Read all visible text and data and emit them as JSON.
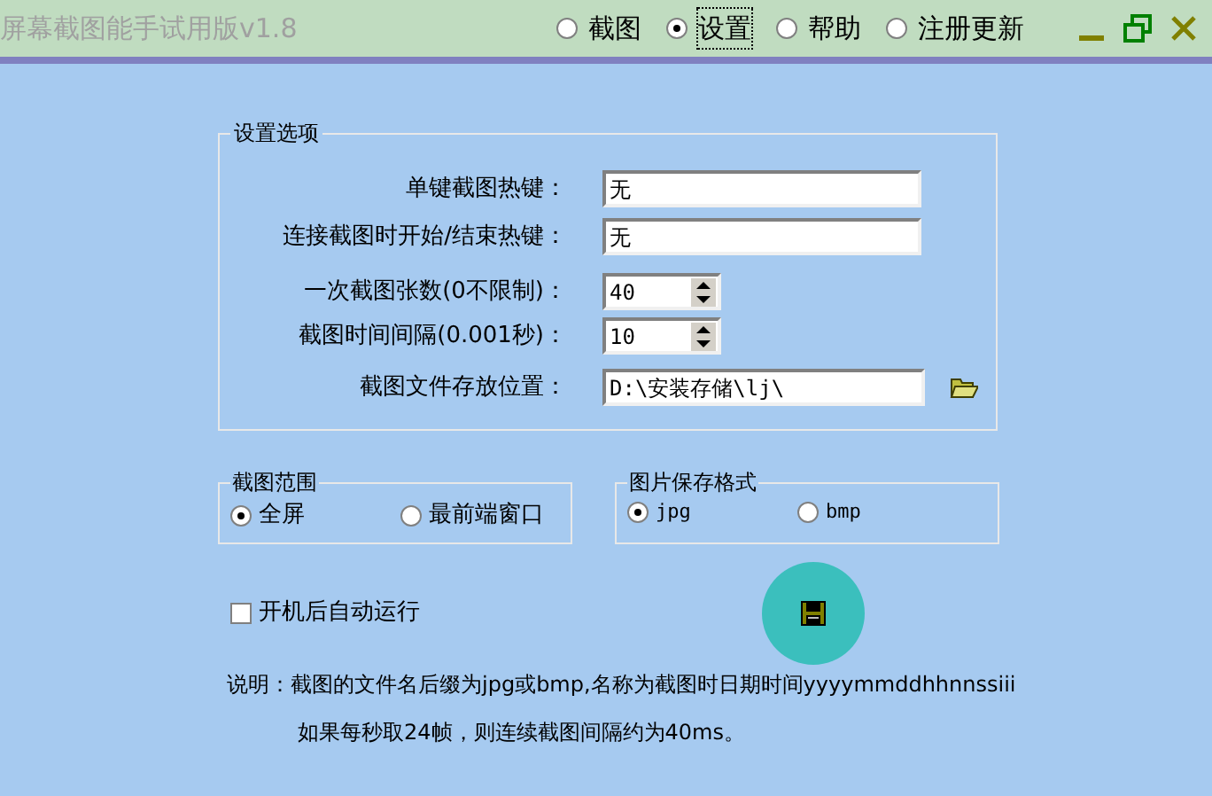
{
  "window": {
    "title": "屏幕截图能手试用版v1.8"
  },
  "nav_tabs": [
    {
      "label": "截图",
      "selected": false
    },
    {
      "label": "设置",
      "selected": true
    },
    {
      "label": "帮助",
      "selected": false
    },
    {
      "label": "注册更新",
      "selected": false
    }
  ],
  "settings_group": {
    "title": "设置选项",
    "fields": [
      {
        "kind": "text",
        "label": "单键截图热键：",
        "value": "无"
      },
      {
        "kind": "text",
        "label": "连接截图时开始/结束热键：",
        "value": "无"
      },
      {
        "kind": "spin",
        "label": "一次截图张数(0不限制)：",
        "value": "40"
      },
      {
        "kind": "spin",
        "label": "截图时间间隔(0.001秒)：",
        "value": "10"
      },
      {
        "kind": "path",
        "label": "截图文件存放位置：",
        "value": "D:\\安装存储\\lj\\"
      }
    ]
  },
  "range_group": {
    "title": "截图范围",
    "options": [
      {
        "label": "全屏",
        "selected": true
      },
      {
        "label": "最前端窗口",
        "selected": false
      }
    ]
  },
  "format_group": {
    "title": "图片保存格式",
    "options": [
      {
        "label": "jpg",
        "selected": true
      },
      {
        "label": "bmp",
        "selected": false
      }
    ]
  },
  "autostart": {
    "label": "开机后自动运行",
    "checked": false
  },
  "notes": [
    "说明：截图的文件名后缀为jpg或bmp,名称为截图时日期时间yyyymmddhhnnssiii",
    "如果每秒取24帧，则连续截图间隔约为40ms。"
  ]
}
